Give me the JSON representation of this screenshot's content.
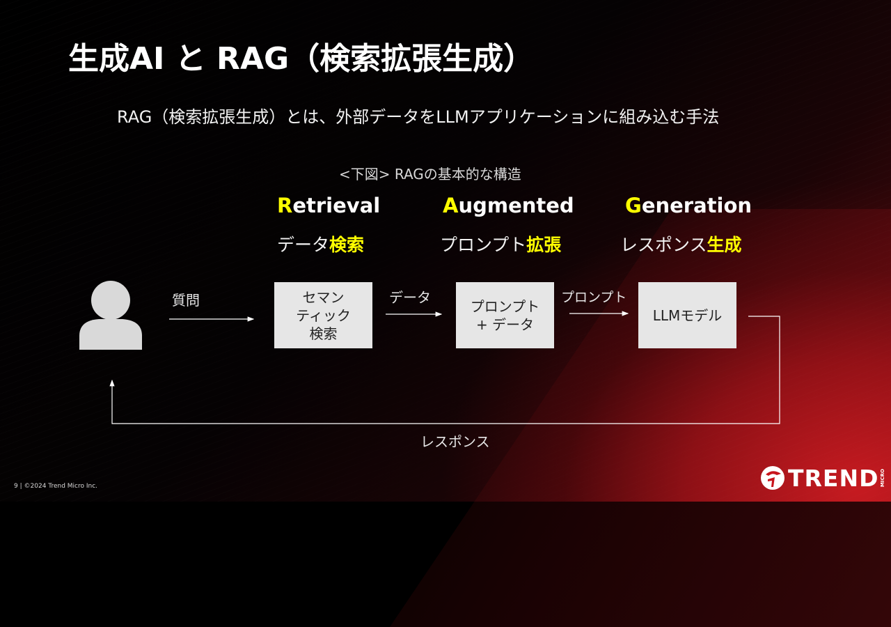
{
  "slide": {
    "title": "生成AI と RAG（検索拡張生成）",
    "subtitle": "RAG（検索拡張生成）とは、外部データをLLMアプリケーションに組み込む手法",
    "caption": "<下図> RAGの基本的な構造"
  },
  "phases": [
    {
      "initial": "R",
      "rest": "etrieval",
      "sub_plain": "データ",
      "sub_highlight": "検索"
    },
    {
      "initial": "A",
      "rest": "ugmented",
      "sub_plain": "プロンプト",
      "sub_highlight": "拡張"
    },
    {
      "initial": "G",
      "rest": "eneration",
      "sub_plain": "レスポンス",
      "sub_highlight": "生成"
    }
  ],
  "flow": {
    "user_icon": "user-icon",
    "arrows": {
      "question": "質問",
      "data": "データ",
      "prompt": "プロンプト",
      "response": "レスポンス"
    },
    "boxes": {
      "semantic_search": [
        "セマン",
        "ティック",
        "検索"
      ],
      "prompt_data": [
        "プロンプト",
        "+ データ"
      ],
      "llm_model": [
        "LLMモデル"
      ]
    }
  },
  "footer": {
    "page_number": "9",
    "copyright": "©2024 Trend Micro Inc.",
    "separator": "|"
  },
  "logo": {
    "brand": "TREND",
    "sub": "MICRO"
  },
  "colors": {
    "accent_yellow": "#ffff00",
    "brand_red": "#d71920",
    "box_fill": "#e6e6e6"
  }
}
